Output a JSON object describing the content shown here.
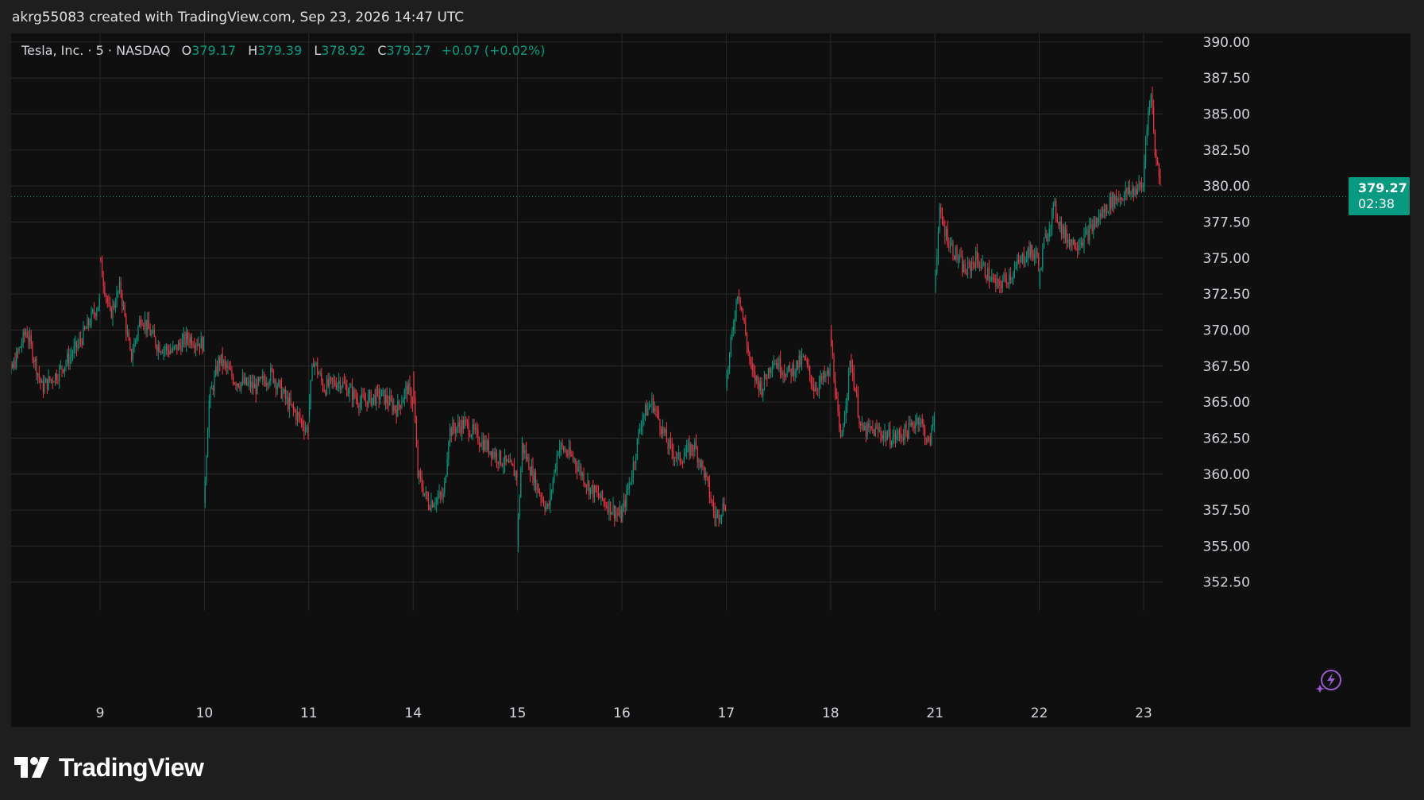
{
  "header": {
    "attribution": "akrg55083 created with TradingView.com, Sep 23, 2026 14:47 UTC"
  },
  "legend": {
    "symbol": "Tesla, Inc. · 5 · NASDAQ",
    "o_label": "O",
    "o": "379.17",
    "h_label": "H",
    "h": "379.39",
    "l_label": "L",
    "l": "378.92",
    "c_label": "C",
    "c": "379.27",
    "change": "+0.07 (+0.02%)"
  },
  "last_price": {
    "price": "379.27",
    "countdown": "02:38"
  },
  "brand": {
    "name": "TradingView"
  },
  "colors": {
    "up": "#089981",
    "down": "#f23645",
    "background": "#0f0f0f",
    "grid": "#2a2a2a",
    "axis_text": "#d1d4dc",
    "accent_bolt": "#9b59d0"
  },
  "icons": {
    "bolt": "lightning-bolt-icon",
    "logo": "tradingview-logo-icon"
  },
  "chart_data": {
    "type": "line",
    "style": "candlestick",
    "title": "Tesla, Inc. · 5 · NASDAQ",
    "xlabel": "",
    "ylabel": "",
    "ylim": [
      350.5,
      390.6
    ],
    "yticks": [
      390.0,
      387.5,
      385.0,
      382.5,
      380.0,
      377.5,
      375.0,
      372.5,
      370.0,
      367.5,
      365.0,
      362.5,
      360.0,
      357.5,
      355.0,
      352.5
    ],
    "ytick_labels": [
      "390.00",
      "387.50",
      "385.00",
      "382.50",
      "380.00",
      "377.50",
      "375.00",
      "372.50",
      "370.00",
      "367.50",
      "365.00",
      "362.50",
      "360.00",
      "357.50",
      "355.00",
      "352.50"
    ],
    "xtick_labels": [
      "9",
      "10",
      "11",
      "14",
      "15",
      "16",
      "17",
      "18",
      "21",
      "22",
      "23"
    ],
    "x_domain": [
      0,
      10.22
    ],
    "grid": true,
    "last_value": 379.27,
    "series": [
      {
        "sessions": [
          {
            "day": "8",
            "x_start": -1.0,
            "points": [
              [
                0.0,
                365
              ],
              [
                0.15,
                367
              ],
              [
                0.3,
                370
              ],
              [
                0.45,
                366
              ],
              [
                0.6,
                367
              ],
              [
                0.8,
                369
              ],
              [
                1.0,
                372
              ]
            ]
          },
          {
            "day": "9",
            "x_start": 0.0,
            "points": [
              [
                0.0,
                375
              ],
              [
                0.1,
                371
              ],
              [
                0.2,
                373
              ],
              [
                0.3,
                368
              ],
              [
                0.4,
                371
              ],
              [
                0.55,
                369
              ],
              [
                0.7,
                368.5
              ],
              [
                0.85,
                369.5
              ],
              [
                1.0,
                369
              ]
            ]
          },
          {
            "day": "10",
            "x_start": 1.0,
            "points": [
              [
                0.0,
                358
              ],
              [
                0.05,
                365
              ],
              [
                0.15,
                368
              ],
              [
                0.3,
                366.5
              ],
              [
                0.5,
                366
              ],
              [
                0.65,
                367
              ],
              [
                0.8,
                365
              ],
              [
                0.9,
                364
              ],
              [
                1.0,
                363
              ]
            ]
          },
          {
            "day": "11",
            "x_start": 2.0,
            "points": [
              [
                0.0,
                364
              ],
              [
                0.05,
                368
              ],
              [
                0.15,
                366
              ],
              [
                0.3,
                366.5
              ],
              [
                0.5,
                365
              ],
              [
                0.7,
                365.5
              ],
              [
                0.85,
                364.5
              ],
              [
                0.95,
                366
              ],
              [
                1.0,
                365
              ]
            ]
          },
          {
            "day": "14",
            "x_start": 3.0,
            "points": [
              [
                0.0,
                367
              ],
              [
                0.05,
                360
              ],
              [
                0.15,
                358
              ],
              [
                0.3,
                358.5
              ],
              [
                0.35,
                363
              ],
              [
                0.5,
                363.5
              ],
              [
                0.7,
                362
              ],
              [
                0.85,
                361
              ],
              [
                1.0,
                360
              ]
            ]
          },
          {
            "day": "15",
            "x_start": 4.0,
            "points": [
              [
                0.0,
                355
              ],
              [
                0.05,
                362
              ],
              [
                0.2,
                359
              ],
              [
                0.3,
                357.5
              ],
              [
                0.4,
                362
              ],
              [
                0.55,
                361
              ],
              [
                0.7,
                359
              ],
              [
                0.85,
                358
              ],
              [
                1.0,
                357
              ]
            ]
          },
          {
            "day": "16",
            "x_start": 5.0,
            "points": [
              [
                0.0,
                357
              ],
              [
                0.1,
                360
              ],
              [
                0.2,
                364
              ],
              [
                0.3,
                365
              ],
              [
                0.45,
                362
              ],
              [
                0.55,
                361
              ],
              [
                0.7,
                362
              ],
              [
                0.8,
                360
              ],
              [
                0.9,
                357
              ],
              [
                1.0,
                358
              ]
            ]
          },
          {
            "day": "17",
            "x_start": 6.0,
            "points": [
              [
                0.0,
                366
              ],
              [
                0.12,
                373
              ],
              [
                0.25,
                367
              ],
              [
                0.35,
                366
              ],
              [
                0.45,
                368
              ],
              [
                0.6,
                367
              ],
              [
                0.75,
                368
              ],
              [
                0.85,
                366
              ],
              [
                1.0,
                367
              ]
            ]
          },
          {
            "day": "18",
            "x_start": 7.0,
            "points": [
              [
                0.0,
                370
              ],
              [
                0.1,
                362
              ],
              [
                0.2,
                368
              ],
              [
                0.3,
                363
              ],
              [
                0.45,
                363
              ],
              [
                0.6,
                362.5
              ],
              [
                0.75,
                363
              ],
              [
                0.85,
                364
              ],
              [
                0.95,
                362
              ],
              [
                1.0,
                364
              ]
            ]
          },
          {
            "day": "21",
            "x_start": 8.0,
            "points": [
              [
                0.0,
                373
              ],
              [
                0.05,
                378
              ],
              [
                0.15,
                376
              ],
              [
                0.3,
                374
              ],
              [
                0.4,
                375
              ],
              [
                0.55,
                373.5
              ],
              [
                0.6,
                373
              ],
              [
                0.75,
                374
              ],
              [
                0.9,
                375.5
              ],
              [
                1.0,
                375
              ]
            ]
          },
          {
            "day": "22",
            "x_start": 9.0,
            "points": [
              [
                0.0,
                373
              ],
              [
                0.05,
                376
              ],
              [
                0.15,
                378.5
              ],
              [
                0.25,
                376.5
              ],
              [
                0.35,
                376
              ],
              [
                0.45,
                376.5
              ],
              [
                0.55,
                377.5
              ],
              [
                0.7,
                379
              ],
              [
                0.85,
                379.5
              ],
              [
                1.0,
                380
              ]
            ]
          },
          {
            "day": "23",
            "x_start": 10.0,
            "points": [
              [
                0.0,
                380
              ],
              [
                0.03,
                384
              ],
              [
                0.08,
                386.5
              ],
              [
                0.12,
                382
              ],
              [
                0.18,
                380
              ],
              [
                0.22,
                379.27
              ]
            ]
          }
        ]
      }
    ]
  }
}
